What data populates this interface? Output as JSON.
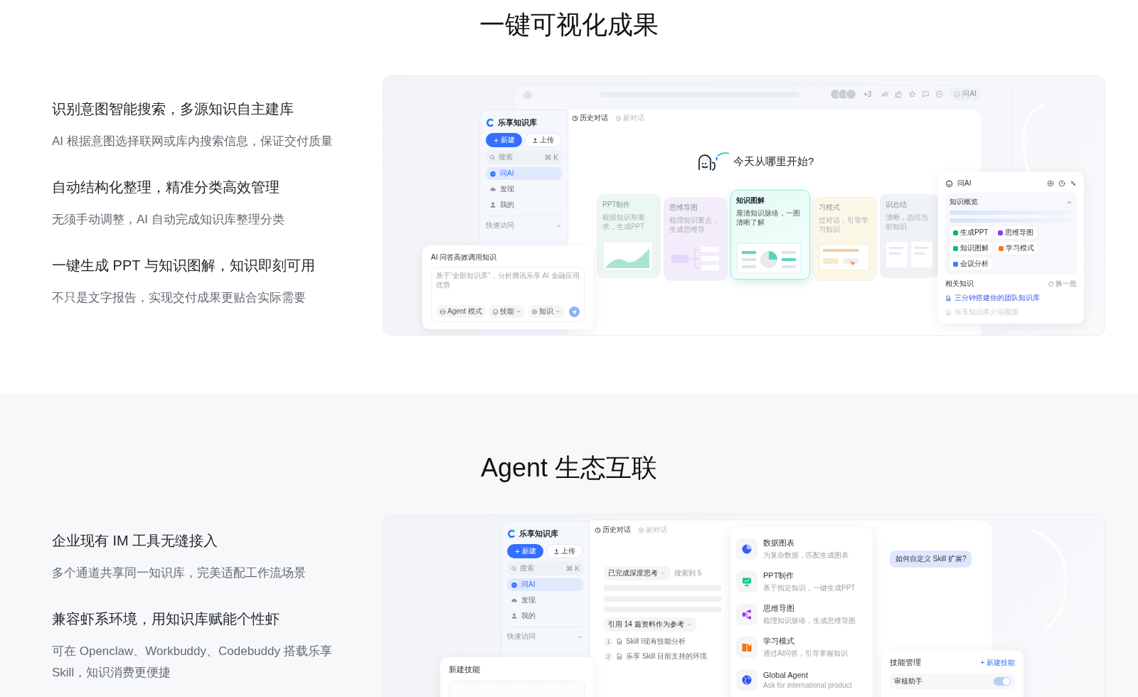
{
  "sections": [
    {
      "title": "一键可视化成果",
      "features": [
        {
          "heading": "识别意图智能搜索，多源知识自主建库",
          "description": "AI 根据意图选择联网或库内搜索信息，保证交付质量"
        },
        {
          "heading": "自动结构化整理，精准分类高效管理",
          "description": "无须手动调整，AI 自动完成知识库整理分类"
        },
        {
          "heading": "一键生成 PPT 与知识图解，知识即刻可用",
          "description": "不只是文字报告，实现交付成果更贴合实际需要"
        }
      ],
      "mockup": {
        "kind": "results",
        "app": {
          "brand": "乐享知识库",
          "new_button": "新建",
          "upload_button": "上传",
          "search_placeholder": "搜索",
          "search_shortcut": "⌘ K",
          "nav": [
            {
              "label": "问AI",
              "selected": true
            },
            {
              "label": "发现",
              "selected": false
            },
            {
              "label": "我的",
              "selected": false
            }
          ],
          "quick_access": "快速访问",
          "tabs": [
            {
              "label": "历史对话",
              "selected": true
            },
            {
              "label": "新对话",
              "selected": false
            }
          ]
        },
        "toolbar": {
          "avatar_more": "+3",
          "ask_button": "问AI"
        },
        "greeting": "今天从哪里开始?",
        "cards": [
          {
            "title": "PPT制作",
            "description": "根据知识和要求，生成PPT",
            "selected": false
          },
          {
            "title": "思维导图",
            "description": "梳理知识要点，生成思维导",
            "selected": false
          },
          {
            "title": "知识图解",
            "description": "厘清知识脉络，一图清晰了解",
            "selected": true
          },
          {
            "title": "习模式",
            "description": "过对话，引导学习知识",
            "selected": false
          },
          {
            "title": "识总结",
            "description": "清晰，总结当前知识",
            "selected": false
          }
        ],
        "chat": {
          "title": "AI 问答高效调用知识",
          "value": "基于“全部知识库”，分析腾讯乐享 AI 金融应用优势",
          "chips": [
            "Agent 模式",
            "技能",
            "知识"
          ]
        },
        "assistant": {
          "title": "问AI",
          "overview": "知识概览",
          "actions": [
            {
              "label": "生成PPT",
              "color": "#16b364"
            },
            {
              "label": "思维导图",
              "color": "#8b3cf6"
            },
            {
              "label": "知识图解",
              "color": "#12b886"
            },
            {
              "label": "学习模式",
              "color": "#f97316"
            },
            {
              "label": "会议分析",
              "color": "#3b82f6"
            }
          ],
          "related": "相关知识",
          "refresh": "换一批",
          "docs": [
            "三分钟搭建你的团队知识库",
            "乐享知识库介绍视频"
          ]
        }
      }
    },
    {
      "title": "Agent 生态互联",
      "features": [
        {
          "heading": "企业现有 IM 工具无缝接入",
          "description": "多个通道共享同一知识库，完美适配工作流场景"
        },
        {
          "heading": "兼容虾系环境，用知识库赋能个性虾",
          "description": "可在 Openclaw、Workbuddy、Codebuddy 搭载乐享 Skill，知识消费更便捷"
        }
      ],
      "mockup": {
        "kind": "agent",
        "app": {
          "brand": "乐享知识库",
          "new_button": "新建",
          "upload_button": "上传",
          "search_placeholder": "搜索",
          "search_shortcut": "⌘ K",
          "nav": [
            {
              "label": "问AI",
              "selected": true
            },
            {
              "label": "发现",
              "selected": false
            },
            {
              "label": "我的",
              "selected": false
            }
          ],
          "quick_access": "快速访问",
          "tabs": [
            {
              "label": "历史对话",
              "selected": true
            },
            {
              "label": "新对话",
              "selected": false
            }
          ]
        },
        "thinking": {
          "status": "已完成深度思考",
          "search_result": "搜索到 5",
          "citations": "引用 14 篇资料作为参考",
          "references": [
            {
              "index": "1",
              "title": "Skill I现有技能分析"
            },
            {
              "index": "2",
              "title": "乐享 Skill 目前支持的环境"
            }
          ]
        },
        "skills": [
          {
            "name": "数据图表",
            "description": "为复杂数据，匹配生成图表",
            "color": "#3b5bf6"
          },
          {
            "name": "PPT制作",
            "description": "基于指定知识，一键生成PPT",
            "color": "#16c784"
          },
          {
            "name": "思维导图",
            "description": "梳理知识脉络，生成思维导图",
            "color": "#9b30f0"
          },
          {
            "name": "学习模式",
            "description": "通过AI问答，引导掌握知识",
            "color": "#f97316"
          },
          {
            "name": "Global Agent",
            "description": "Ask for international product",
            "color": "#2f4ff0"
          }
        ],
        "question": "如何自定义 Skill 扩展?",
        "new_skill": {
          "title": "新建技能"
        },
        "skill_manager": {
          "title": "技能管理",
          "add_button": "+ 新建技能",
          "items": [
            {
              "label": "审核助手",
              "on": true
            }
          ]
        }
      }
    }
  ]
}
